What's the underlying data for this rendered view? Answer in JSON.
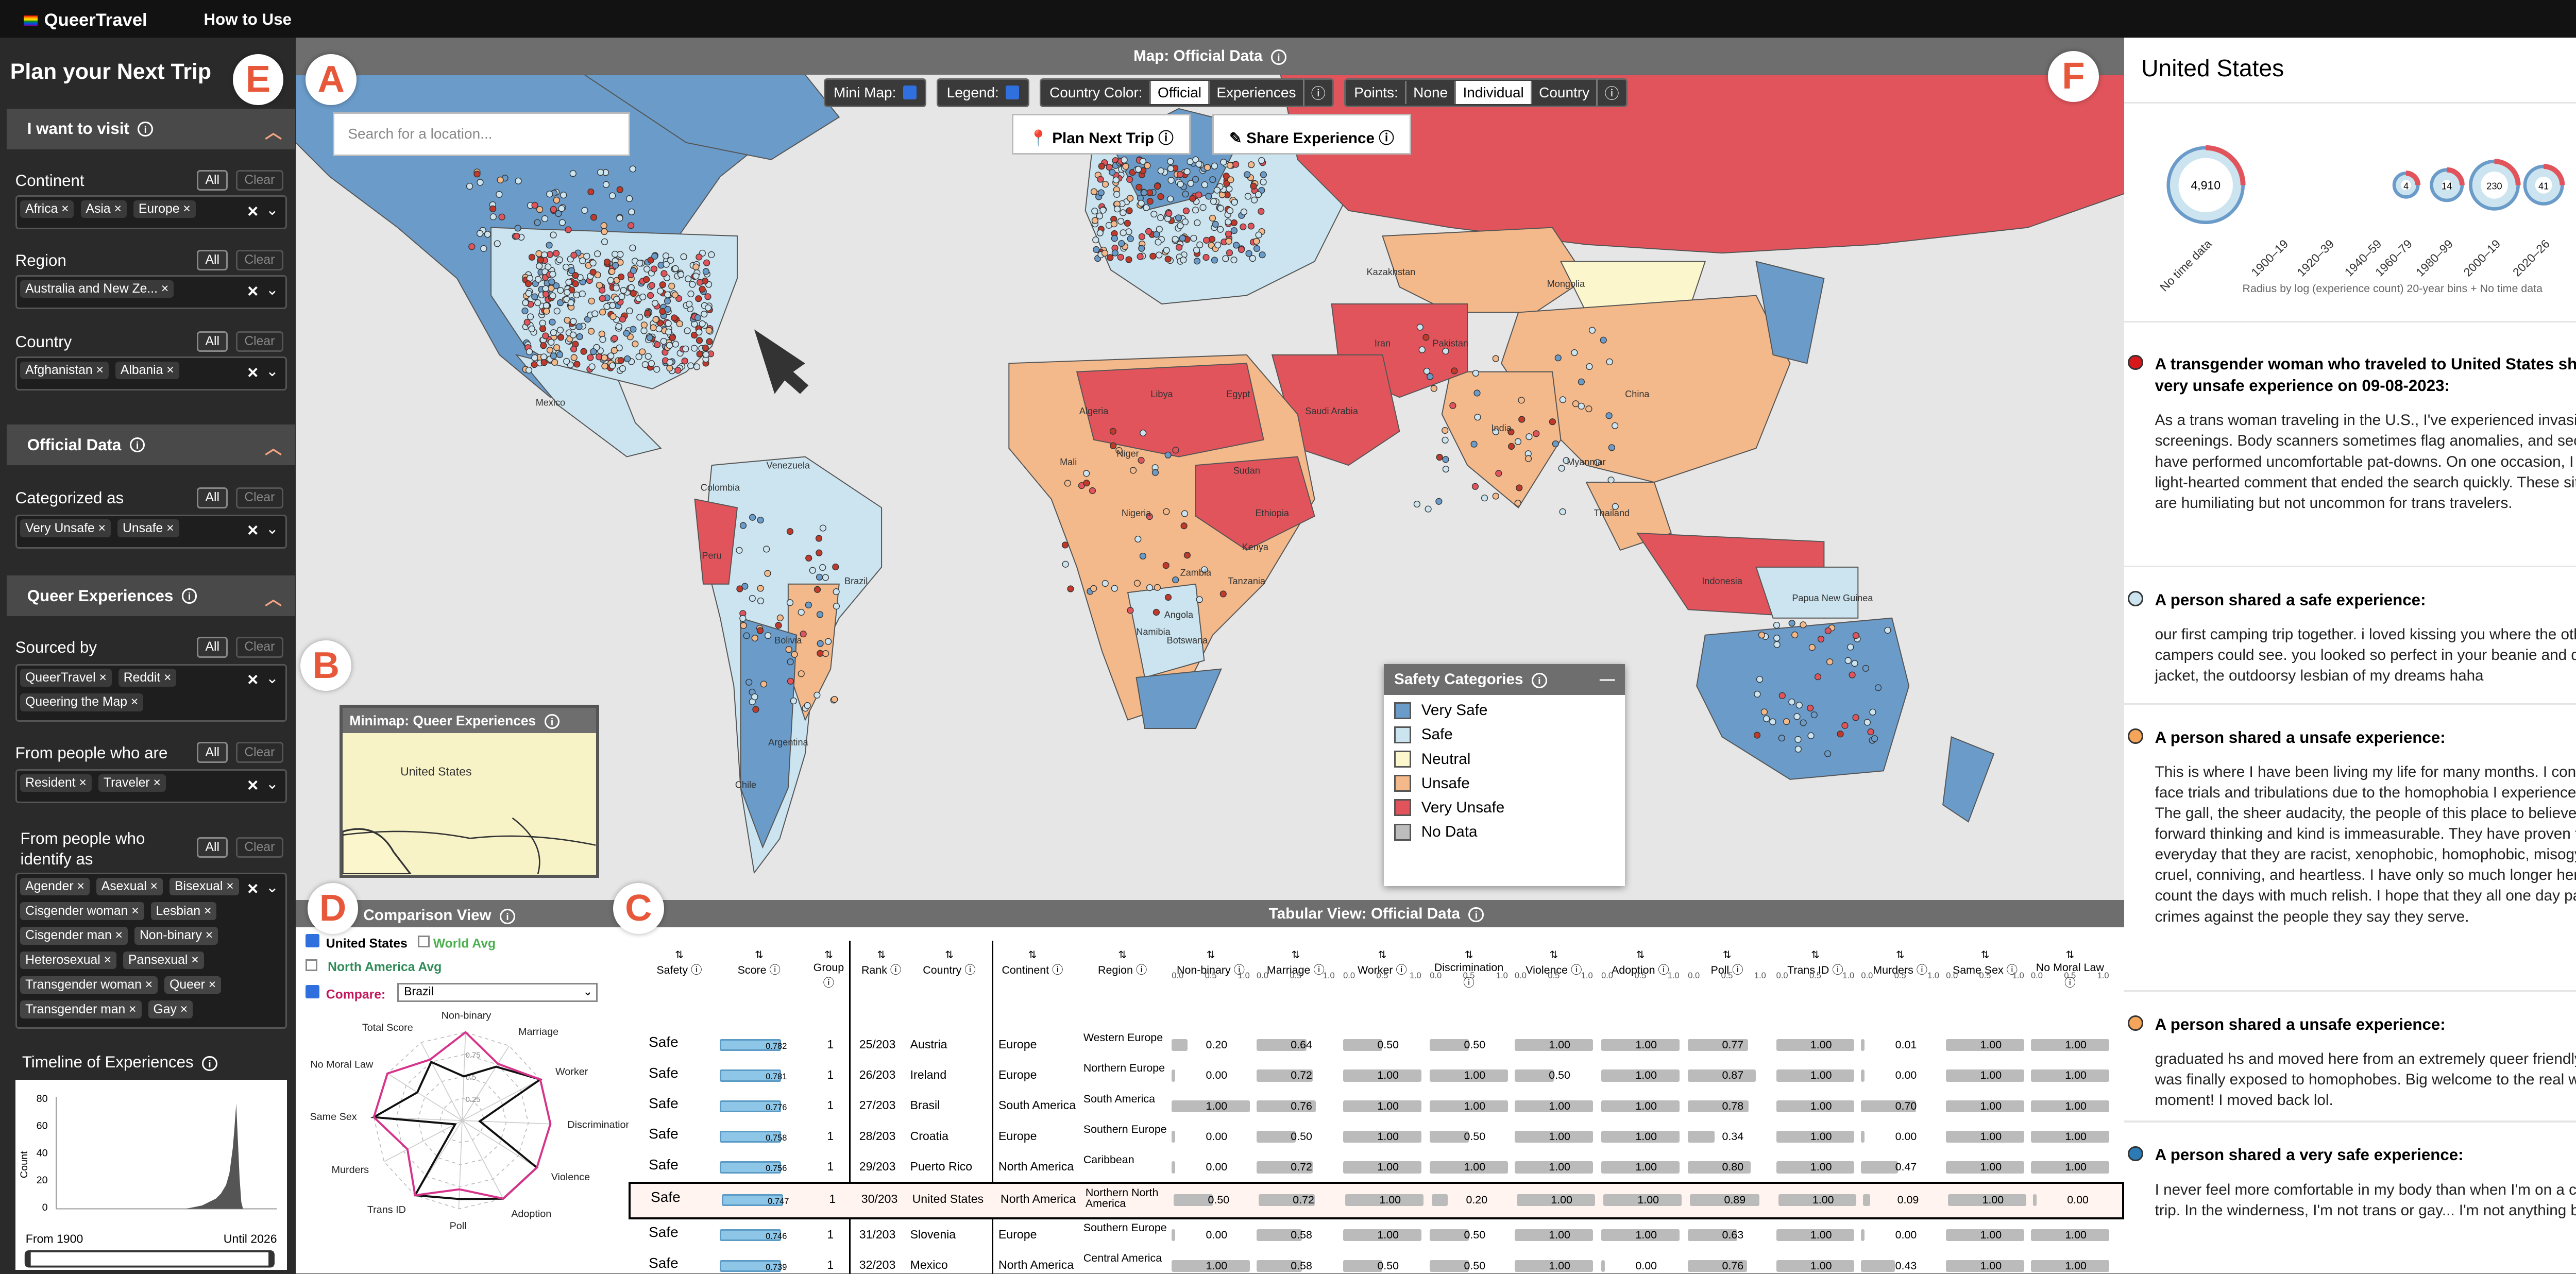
{
  "app": {
    "name": "QueerTravel",
    "nav": "How to Use"
  },
  "left": {
    "title": "Plan your Next Trip",
    "visit": {
      "header": "I want to visit",
      "continent": {
        "label": "Continent",
        "tags": [
          "Africa",
          "Asia",
          "Europe"
        ]
      },
      "region": {
        "label": "Region",
        "tags": [
          "Australia and New Ze..."
        ]
      },
      "country": {
        "label": "Country",
        "tags": [
          "Afghanistan",
          "Albania"
        ]
      }
    },
    "official": {
      "header": "Official Data",
      "categorized": {
        "label": "Categorized as",
        "tags": [
          "Very Unsafe",
          "Unsafe"
        ]
      }
    },
    "queer": {
      "header": "Queer Experiences",
      "sourced": {
        "label": "Sourced by",
        "tags": [
          "QueerTravel",
          "Reddit",
          "Queering the Map"
        ]
      },
      "from": {
        "label": "From people who are",
        "tags": [
          "Resident",
          "Traveler"
        ]
      },
      "identify": {
        "label": "From people who identify as",
        "tags": [
          "Agender",
          "Asexual",
          "Bisexual",
          "Cisgender woman",
          "Lesbian",
          "Cisgender man",
          "Non-binary",
          "Heterosexual",
          "Pansexual",
          "Transgender woman",
          "Queer",
          "Transgender man",
          "Gay"
        ]
      }
    },
    "timeline": {
      "label": "Timeline of Experiences",
      "y_ticks": [
        "80",
        "60",
        "40",
        "20",
        "0"
      ],
      "ylabel": "Count",
      "from": "From 1900",
      "until": "Until 2026"
    },
    "all": "All",
    "clear": "Clear"
  },
  "map": {
    "title": "Map: Official Data",
    "minimap_label": "Mini Map:",
    "legend_label": "Legend:",
    "country_color_label": "Country Color:",
    "cc_official": "Official",
    "cc_experiences": "Experiences",
    "points_label": "Points:",
    "pt_none": "None",
    "pt_individual": "Individual",
    "pt_country": "Country",
    "search_placeholder": "Search for a location...",
    "plan_button": "Plan Next Trip",
    "share_button": "Share Experience",
    "minimap_title": "Minimap: Queer Experiences",
    "minimap_country": "United States",
    "country_labels": [
      "Kazakhstan",
      "Mongolia",
      "China",
      "Brazil",
      "Argentina",
      "Venezuela",
      "Colombia",
      "Libya",
      "Egypt",
      "Mali",
      "Niger",
      "Sudan",
      "Ethiopia",
      "Angola",
      "Indonesia",
      "Papua New Guinea",
      "Mexico",
      "India",
      "Iran",
      "Algeria",
      "Peru",
      "Bolivia",
      "Chile",
      "Nigeria",
      "Namibia",
      "Botswana",
      "Saudi Arabia",
      "Pakistan",
      "Myanmar",
      "Thailand",
      "Kenya",
      "Tanzania",
      "Zambia"
    ],
    "legend": {
      "title": "Safety Categories",
      "items": [
        {
          "label": "Very Safe",
          "color": "#6a9bc9"
        },
        {
          "label": "Safe",
          "color": "#cbe4ef"
        },
        {
          "label": "Neutral",
          "color": "#fbf6cc"
        },
        {
          "label": "Unsafe",
          "color": "#f4b98a"
        },
        {
          "label": "Very Unsafe",
          "color": "#e2545c"
        },
        {
          "label": "No Data",
          "color": "#bdbdbd"
        }
      ]
    }
  },
  "compare": {
    "title": "Comparison View",
    "us": "United States",
    "world": "World Avg",
    "na": "North America Avg",
    "compare_label": "Compare:",
    "compare_value": "Brazil",
    "axes": [
      "Non-binary",
      "Marriage",
      "Worker",
      "Discrimination",
      "Violence",
      "Adoption",
      "Poll",
      "Trans ID",
      "Murders",
      "Same Sex",
      "No Moral Law",
      "Total Score"
    ],
    "ticks": [
      "0.75",
      "0.5",
      "0.25"
    ]
  },
  "table": {
    "title": "Tabular View: Official Data",
    "columns": [
      "Safety",
      "Score",
      "Group",
      "Rank",
      "Country",
      "Continent",
      "Region",
      "Non-binary",
      "Marriage",
      "Worker",
      "Discrimination",
      "Violence",
      "Adoption",
      "Poll",
      "Trans ID",
      "Murders",
      "Same Sex",
      "No Moral Law"
    ],
    "scale": [
      "0",
      "50",
      "100",
      "0.0",
      "0.5",
      "1.0"
    ],
    "rows": [
      {
        "safety": "Safe",
        "score": "0.782",
        "group": "1",
        "rank": "25/203",
        "country": "Austria",
        "continent": "Europe",
        "region": "Western Europe",
        "vals": [
          "0.20",
          "0.64",
          "0.50",
          "0.50",
          "1.00",
          "1.00",
          "0.77",
          "1.00",
          "0.01",
          "1.00",
          "1.00"
        ]
      },
      {
        "safety": "Safe",
        "score": "0.781",
        "group": "1",
        "rank": "26/203",
        "country": "Ireland",
        "continent": "Europe",
        "region": "Northern Europe",
        "vals": [
          "0.00",
          "0.72",
          "1.00",
          "1.00",
          "0.50",
          "1.00",
          "0.87",
          "1.00",
          "0.00",
          "1.00",
          "1.00"
        ]
      },
      {
        "safety": "Safe",
        "score": "0.776",
        "group": "1",
        "rank": "27/203",
        "country": "Brasil",
        "continent": "South America",
        "region": "South America",
        "vals": [
          "1.00",
          "0.76",
          "1.00",
          "1.00",
          "1.00",
          "1.00",
          "0.78",
          "1.00",
          "0.70",
          "1.00",
          "1.00"
        ]
      },
      {
        "safety": "Safe",
        "score": "0.758",
        "group": "1",
        "rank": "28/203",
        "country": "Croatia",
        "continent": "Europe",
        "region": "Southern Europe",
        "vals": [
          "0.00",
          "0.50",
          "1.00",
          "0.50",
          "1.00",
          "1.00",
          "0.34",
          "1.00",
          "0.00",
          "1.00",
          "1.00"
        ]
      },
      {
        "safety": "Safe",
        "score": "0.756",
        "group": "1",
        "rank": "29/203",
        "country": "Puerto Rico",
        "continent": "North America",
        "region": "Caribbean",
        "vals": [
          "0.00",
          "0.72",
          "1.00",
          "1.00",
          "1.00",
          "1.00",
          "0.80",
          "1.00",
          "0.47",
          "1.00",
          "1.00"
        ]
      },
      {
        "safety": "Safe",
        "score": "0.747",
        "group": "1",
        "rank": "30/203",
        "country": "United States",
        "continent": "North America",
        "region": "Northern North America",
        "vals": [
          "0.50",
          "0.72",
          "1.00",
          "0.20",
          "1.00",
          "1.00",
          "0.89",
          "1.00",
          "0.09",
          "1.00",
          "0.00"
        ]
      },
      {
        "safety": "Safe",
        "score": "0.746",
        "group": "1",
        "rank": "31/203",
        "country": "Slovenia",
        "continent": "Europe",
        "region": "Southern Europe",
        "vals": [
          "0.00",
          "0.58",
          "1.00",
          "0.50",
          "1.00",
          "1.00",
          "0.63",
          "1.00",
          "0.00",
          "1.00",
          "1.00"
        ]
      },
      {
        "safety": "Safe",
        "score": "0.739",
        "group": "1",
        "rank": "32/203",
        "country": "Mexico",
        "continent": "North America",
        "region": "Central America",
        "vals": [
          "1.00",
          "0.58",
          "0.50",
          "0.50",
          "1.00",
          "0.00",
          "0.76",
          "1.00",
          "0.43",
          "1.00",
          "1.00"
        ]
      }
    ]
  },
  "right": {
    "title": "United States",
    "timeline": {
      "bins": [
        "No time data",
        "1900–19",
        "1920–39",
        "1940–59",
        "1960–79",
        "1980–99",
        "2000–19",
        "2020–26"
      ],
      "counts": [
        "4,910",
        "",
        "",
        "",
        "4",
        "14",
        "230",
        "41"
      ],
      "caption": "Radius by log (experience count) 20-year bins + No time data"
    },
    "experiences": [
      {
        "color": "#d7191c",
        "head": "A transgender woman who traveled to United States shared a very unsafe experience on 09-08-2023:",
        "body": "As a trans woman traveling in the U.S., I've experienced invasive airport screenings. Body scanners sometimes flag anomalies, and security staff have performed uncomfortable pat-downs. On one occasion, I made a light-hearted comment that ended the search quickly. These situations are humiliating but not uncommon for trans travelers."
      },
      {
        "color": "#cbe4ef",
        "head": "A person shared a safe experience:",
        "body": "our first camping trip together. i loved kissing you where the other campers could see. you looked so perfect in your beanie and down jacket, the outdoorsy lesbian of my dreams haha"
      },
      {
        "color": "#f4a55a",
        "head": "A person shared a unsafe experience:",
        "body": "This is where I have been living my life for many months. I continue to face trials and tribulations due to the homophobia I experience at my job. The gall, the sheer audacity, the people of this place to believe they are forward thinking and kind is immeasurable.  They have proven to me everyday that they are racist, xenophobic, homophobic, misogynistic, cruel, conniving, and heartless. I have only so much longer here and I count the days with much relish. I hope that they all one day pay for their crimes against the people they say they serve."
      },
      {
        "color": "#f4a55a",
        "head": "A person shared a unsafe experience:",
        "body": "graduated hs and moved here from an extremely queer friendly town, I was finally exposed to homophobes. Big welcome to the real world moment! I moved back lol."
      },
      {
        "color": "#2c7bb6",
        "head": "A person shared a very safe experience:",
        "body": "I never feel more comfortable in my body than when I'm on a camping trip. In the winderness, I'm not trans or gay... I'm not anything but me."
      }
    ]
  },
  "annotations": [
    "A",
    "B",
    "C",
    "D",
    "E",
    "F"
  ]
}
